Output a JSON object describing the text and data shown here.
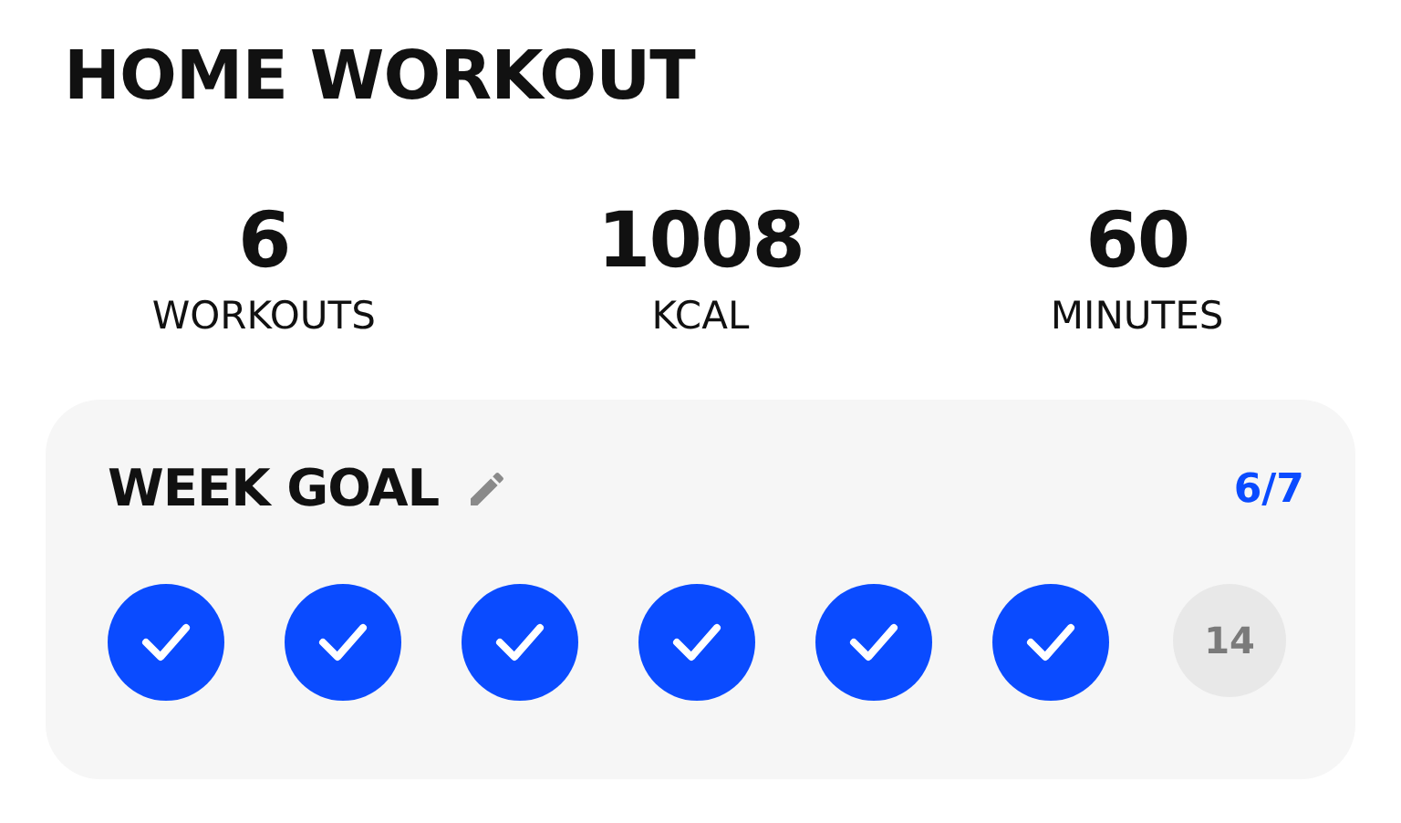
{
  "title": "HOME WORKOUT",
  "stats": [
    {
      "value": "6",
      "label": "WORKOUTS"
    },
    {
      "value": "1008",
      "label": "KCAL"
    },
    {
      "value": "60",
      "label": "MINUTES"
    }
  ],
  "week_goal": {
    "title": "WEEK GOAL",
    "progress": "6/7",
    "days": [
      {
        "checked": true
      },
      {
        "checked": true
      },
      {
        "checked": true
      },
      {
        "checked": true
      },
      {
        "checked": true
      },
      {
        "checked": true
      },
      {
        "checked": false,
        "label": "14"
      }
    ]
  }
}
